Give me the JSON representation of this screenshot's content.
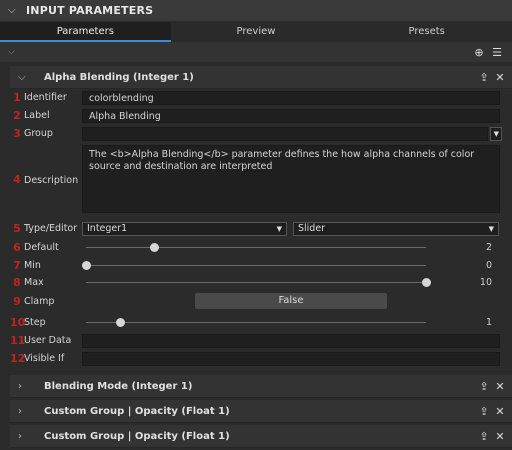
{
  "panel": {
    "title": "INPUT PARAMETERS"
  },
  "tabs": [
    {
      "label": "Parameters"
    },
    {
      "label": "Preview"
    },
    {
      "label": "Presets"
    }
  ],
  "toolbar": {
    "add_icon": "plus-circle-icon",
    "menu_icon": "list-menu-icon"
  },
  "expanded": {
    "title": "Alpha Blending (Integer 1)",
    "rows": {
      "identifier": {
        "num": "1",
        "label": "Identifier",
        "value": "colorblending"
      },
      "label": {
        "num": "2",
        "label": "Label",
        "value": "Alpha Blending"
      },
      "group": {
        "num": "3",
        "label": "Group",
        "value": ""
      },
      "description": {
        "num": "4",
        "label": "Description",
        "value": "The <b>Alpha Blending</b> parameter defines the how alpha channels of color source and destination are interpreted"
      },
      "type": {
        "num": "5",
        "label": "Type/Editor",
        "type_value": "Integer1",
        "editor_value": "Slider"
      },
      "default": {
        "num": "6",
        "label": "Default",
        "value": "2",
        "fraction": 0.2
      },
      "min": {
        "num": "7",
        "label": "Min",
        "value": "0",
        "fraction": 0.0
      },
      "max": {
        "num": "8",
        "label": "Max",
        "value": "10",
        "fraction": 1.0
      },
      "clamp": {
        "num": "9",
        "label": "Clamp",
        "value": "False"
      },
      "step": {
        "num": "10",
        "label": "Step",
        "value": "1",
        "fraction": 0.1
      },
      "userdata": {
        "num": "11",
        "label": "User Data",
        "value": ""
      },
      "visibleif": {
        "num": "12",
        "label": "Visible If",
        "value": ""
      }
    }
  },
  "collapsed": [
    {
      "title": "Blending Mode (Integer 1)"
    },
    {
      "title": "Custom Group | Opacity (Float 1)"
    },
    {
      "title": "Custom Group | Opacity (Float 1)"
    }
  ],
  "colors": {
    "accent": "#3d8bd6",
    "number_marker": "#c0241d"
  }
}
